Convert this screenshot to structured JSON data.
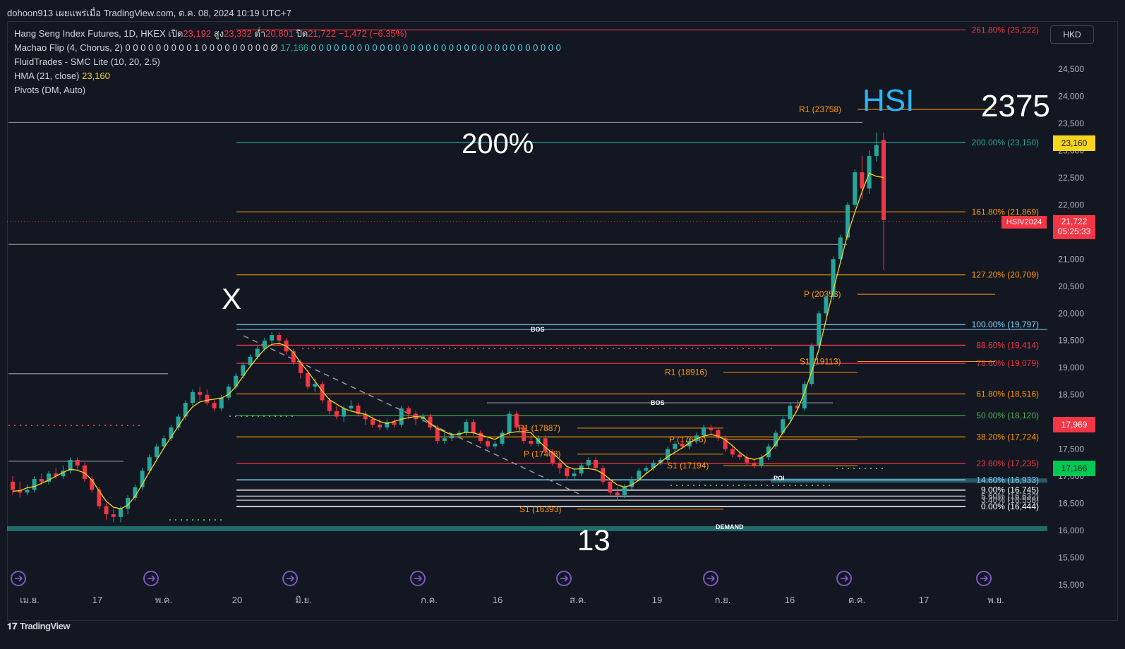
{
  "header": {
    "attribution": "dohoon913 เผยแพร่เมื่อ TradingView.com, ต.ค. 08, 2024 10:19 UTC+7"
  },
  "legend": {
    "symbol": "Hang Seng Index Futures, 1D, HKEX",
    "open_label": "เปิด",
    "open": "23,192",
    "high_label": "สูง",
    "high": "23,332",
    "low_label": "ต่ำ",
    "low": "20,801",
    "close_label": "ปิด",
    "close": "21,722",
    "change": "−1,472 (−6.35%)",
    "machao": "Machao Flip (4, Chorus, 2)",
    "machao_values": "0 0 0 0 0 0 0 0 0 1 0 0 0 0 0 0 0 0 0 Ø",
    "machao_val": "17,166",
    "machao_values2": "0 0 0 0 0 0 0 0 0 0 0 0 0 0 0 0 0 0 0 0 0 0 0 0 0 0 0 0 0 0 0 0 0",
    "fluid": "FluidTrades - SMC Lite  (10, 20, 2.5)",
    "hma": "HMA (21, close)",
    "hma_val": "23,160",
    "pivots": "Pivots (DM, Auto)"
  },
  "currency": "HKD",
  "footer": {
    "brand": "TradingView"
  },
  "annotations": {
    "hsi": "HSI",
    "target": "2375",
    "pct200": "200%",
    "x": "X",
    "thirteen": "13",
    "bos1": "BOS",
    "bos2": "BOS",
    "poi": "POI",
    "demand": "DEMAND"
  },
  "price_boxes": {
    "hma": "23,160",
    "close": "21,722",
    "countdown": "05:25:33",
    "contract": "HSIV2024",
    "red": "17,969",
    "green": "17,166"
  },
  "chart_data": {
    "type": "candlestick",
    "y_axis": {
      "min": 15000,
      "max": 24500,
      "ticks": [
        15000,
        15500,
        16000,
        16500,
        17000,
        17500,
        18000,
        18500,
        19000,
        19500,
        20000,
        20500,
        21000,
        21500,
        22000,
        22500,
        23000,
        23500,
        24000,
        24500
      ]
    },
    "x_ticks": [
      "เม.ย.",
      "17",
      "พ.ค.",
      "20",
      "มิ.ย.",
      "ก.ค.",
      "16",
      "ส.ค.",
      "19",
      "ก.ย.",
      "16",
      "ต.ค.",
      "17",
      "พ.ย."
    ],
    "fib_levels": [
      {
        "label": "261.80% (25,222)",
        "value": 25222,
        "color": "#f23645"
      },
      {
        "label": "200.00% (23,150)",
        "value": 23150,
        "color": "#26a69a"
      },
      {
        "label": "161.80% (21,869)",
        "value": 21869,
        "color": "#ff9800"
      },
      {
        "label": "127.20% (20,709)",
        "value": 20709,
        "color": "#ff9800"
      },
      {
        "label": "100.00% (19,797)",
        "value": 19797,
        "color": "#81d4fa"
      },
      {
        "label": "88.60% (19,414)",
        "value": 19414,
        "color": "#f23645"
      },
      {
        "label": "78.60% (19,079)",
        "value": 19079,
        "color": "#f23645"
      },
      {
        "label": "61.80% (18,516)",
        "value": 18516,
        "color": "#ff9800"
      },
      {
        "label": "50.00% (18,120)",
        "value": 18120,
        "color": "#4caf50"
      },
      {
        "label": "38.20% (17,724)",
        "value": 17724,
        "color": "#ff9800"
      },
      {
        "label": "23.60% (17,235)",
        "value": 17235,
        "color": "#f23645"
      },
      {
        "label": "14.60% (16,933)",
        "value": 16933,
        "color": "#81d4fa"
      },
      {
        "label": "9.00% (16,745)",
        "value": 16745,
        "color": "#ffffff"
      },
      {
        "label": "5.60% (16,632)",
        "value": 16632,
        "color": "#b2b5be"
      },
      {
        "label": "3.40% (16,558)",
        "value": 16558,
        "color": "#b2b5be"
      },
      {
        "label": "0.00% (16,444)",
        "value": 16444,
        "color": "#ffffff"
      }
    ],
    "pivots": [
      {
        "label": "R1 (23758)",
        "value": 23758
      },
      {
        "label": "P (20353)",
        "value": 20353
      },
      {
        "label": "S1 (19113)",
        "value": 19113
      },
      {
        "label": "R1 (18916)",
        "value": 18916
      },
      {
        "label": "R1 (17887)",
        "value": 17887
      },
      {
        "label": "P (17676)",
        "value": 17676
      },
      {
        "label": "P (17408)",
        "value": 17408
      },
      {
        "label": "S1 (17194)",
        "value": 17194
      },
      {
        "label": "S1 (16393)",
        "value": 16393
      }
    ],
    "candles": [
      [
        16900,
        16750,
        17000,
        16650
      ],
      [
        16750,
        16700,
        16900,
        16600
      ],
      [
        16700,
        16750,
        16850,
        16650
      ],
      [
        16750,
        16950,
        17000,
        16700
      ],
      [
        16950,
        16900,
        17050,
        16850
      ],
      [
        16900,
        17050,
        17100,
        16850
      ],
      [
        17050,
        17000,
        17150,
        16950
      ],
      [
        17000,
        17100,
        17200,
        16950
      ],
      [
        17100,
        17300,
        17350,
        17050
      ],
      [
        17300,
        17200,
        17350,
        17100
      ],
      [
        17200,
        16950,
        17250,
        16900
      ],
      [
        16950,
        16750,
        17000,
        16700
      ],
      [
        16750,
        16450,
        16800,
        16400
      ],
      [
        16450,
        16300,
        16500,
        16200
      ],
      [
        16300,
        16250,
        16400,
        16150
      ],
      [
        16250,
        16400,
        16450,
        16150
      ],
      [
        16400,
        16600,
        16650,
        16300
      ],
      [
        16600,
        16800,
        16850,
        16550
      ],
      [
        16800,
        17100,
        17150,
        16750
      ],
      [
        17100,
        17350,
        17400,
        17050
      ],
      [
        17350,
        17550,
        17600,
        17300
      ],
      [
        17550,
        17700,
        17750,
        17500
      ],
      [
        17700,
        17900,
        17950,
        17650
      ],
      [
        17900,
        18100,
        18150,
        17850
      ],
      [
        18100,
        18350,
        18400,
        18050
      ],
      [
        18350,
        18550,
        18600,
        18300
      ],
      [
        18550,
        18500,
        18650,
        18400
      ],
      [
        18500,
        18350,
        18600,
        18300
      ],
      [
        18350,
        18250,
        18400,
        18200
      ],
      [
        18250,
        18450,
        18500,
        18200
      ],
      [
        18450,
        18650,
        18700,
        18400
      ],
      [
        18650,
        18850,
        18900,
        18600
      ],
      [
        18850,
        19050,
        19100,
        18800
      ],
      [
        19050,
        19200,
        19250,
        19000
      ],
      [
        19200,
        19350,
        19400,
        19150
      ],
      [
        19350,
        19500,
        19550,
        19300
      ],
      [
        19500,
        19600,
        19650,
        19450
      ],
      [
        19600,
        19500,
        19650,
        19400
      ],
      [
        19500,
        19300,
        19550,
        19250
      ],
      [
        19300,
        19100,
        19350,
        19050
      ],
      [
        19100,
        18900,
        19150,
        18800
      ],
      [
        18900,
        18650,
        18950,
        18600
      ],
      [
        18650,
        18700,
        18800,
        18550
      ],
      [
        18700,
        18400,
        18750,
        18350
      ],
      [
        18400,
        18200,
        18450,
        18150
      ],
      [
        18200,
        18100,
        18300,
        18050
      ],
      [
        18100,
        18250,
        18300,
        18000
      ],
      [
        18250,
        18300,
        18400,
        18200
      ],
      [
        18300,
        18150,
        18350,
        18100
      ],
      [
        18150,
        18050,
        18200,
        17950
      ],
      [
        18050,
        17950,
        18100,
        17900
      ],
      [
        17950,
        17900,
        18050,
        17850
      ],
      [
        17900,
        18000,
        18050,
        17850
      ],
      [
        18000,
        17950,
        18050,
        17900
      ],
      [
        17950,
        18250,
        18300,
        17900
      ],
      [
        18250,
        18150,
        18300,
        18050
      ],
      [
        18150,
        18050,
        18200,
        17950
      ],
      [
        18050,
        18100,
        18150,
        18000
      ],
      [
        18100,
        17900,
        18150,
        17850
      ],
      [
        17900,
        17650,
        17950,
        17600
      ],
      [
        17650,
        17700,
        17800,
        17600
      ],
      [
        17700,
        17750,
        17800,
        17650
      ],
      [
        17750,
        17800,
        17850,
        17700
      ],
      [
        17800,
        18000,
        18050,
        17750
      ],
      [
        18000,
        17800,
        18050,
        17750
      ],
      [
        17800,
        17650,
        17850,
        17600
      ],
      [
        17650,
        17550,
        17700,
        17500
      ],
      [
        17550,
        17600,
        17650,
        17500
      ],
      [
        17600,
        17800,
        17850,
        17550
      ],
      [
        17800,
        18150,
        18200,
        17750
      ],
      [
        18150,
        17900,
        18200,
        17850
      ],
      [
        17900,
        17650,
        17950,
        17600
      ],
      [
        17650,
        17600,
        17750,
        17550
      ],
      [
        17600,
        17700,
        17750,
        17550
      ],
      [
        17700,
        17450,
        17750,
        17400
      ],
      [
        17450,
        17250,
        17500,
        17200
      ],
      [
        17250,
        17150,
        17300,
        17050
      ],
      [
        17150,
        17000,
        17200,
        16950
      ],
      [
        17000,
        17050,
        17150,
        16950
      ],
      [
        17050,
        17200,
        17250,
        17000
      ],
      [
        17200,
        17300,
        17350,
        17150
      ],
      [
        17300,
        17150,
        17350,
        17100
      ],
      [
        17150,
        16900,
        17200,
        16850
      ],
      [
        16900,
        16700,
        16950,
        16650
      ],
      [
        16700,
        16650,
        16800,
        16550
      ],
      [
        16650,
        16800,
        16850,
        16600
      ],
      [
        16800,
        16950,
        17000,
        16750
      ],
      [
        16950,
        17100,
        17150,
        16900
      ],
      [
        17100,
        17150,
        17200,
        17050
      ],
      [
        17150,
        17250,
        17300,
        17100
      ],
      [
        17250,
        17300,
        17350,
        17200
      ],
      [
        17300,
        17500,
        17550,
        17250
      ],
      [
        17500,
        17600,
        17650,
        17450
      ],
      [
        17600,
        17550,
        17700,
        17500
      ],
      [
        17550,
        17650,
        17700,
        17500
      ],
      [
        17650,
        17750,
        17800,
        17600
      ],
      [
        17750,
        17900,
        17950,
        17700
      ],
      [
        17900,
        17850,
        17950,
        17750
      ],
      [
        17850,
        17700,
        17900,
        17650
      ],
      [
        17700,
        17500,
        17750,
        17450
      ],
      [
        17500,
        17400,
        17550,
        17350
      ],
      [
        17400,
        17350,
        17450,
        17300
      ],
      [
        17350,
        17250,
        17400,
        17200
      ],
      [
        17250,
        17200,
        17300,
        17150
      ],
      [
        17200,
        17350,
        17400,
        17150
      ],
      [
        17350,
        17550,
        17600,
        17300
      ],
      [
        17550,
        17800,
        17850,
        17500
      ],
      [
        17800,
        18050,
        18100,
        17750
      ],
      [
        18050,
        18300,
        18350,
        18000
      ],
      [
        18300,
        18250,
        18400,
        18200
      ],
      [
        18250,
        18700,
        18750,
        18200
      ],
      [
        18700,
        19400,
        19450,
        18650
      ],
      [
        19400,
        20000,
        20050,
        19350
      ],
      [
        20000,
        20300,
        20350,
        19950
      ],
      [
        20300,
        21000,
        21050,
        20250
      ],
      [
        21000,
        21400,
        21450,
        20950
      ],
      [
        21400,
        22000,
        22050,
        21350
      ],
      [
        22000,
        22600,
        22650,
        21950
      ],
      [
        22600,
        22300,
        22900,
        22100
      ],
      [
        22300,
        22900,
        23000,
        22200
      ],
      [
        22900,
        23100,
        23332,
        22800
      ],
      [
        23192,
        21722,
        23332,
        20801
      ]
    ]
  }
}
